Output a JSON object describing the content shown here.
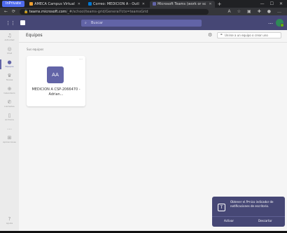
{
  "browser": {
    "profile": "InPrivate",
    "tabs": [
      {
        "label": "AMECA Campus Virtual",
        "color": "#f0a030",
        "active": false
      },
      {
        "label": "Correo: MEDICION A - Outl",
        "color": "#0078d4",
        "active": false
      },
      {
        "label": "Microsoft Teams (work or sc",
        "color": "#6264a7",
        "active": true
      }
    ],
    "new_tab": "+",
    "url_host": "teams.microsoft.com",
    "url_path": "/_#/school/teams-grid/General?ctx=teamsGrid"
  },
  "teams_header": {
    "search_placeholder": "Buscar"
  },
  "rail": {
    "items": [
      {
        "icon": "bell-icon",
        "label": "Actividad"
      },
      {
        "icon": "chat-icon",
        "label": "Chat"
      },
      {
        "icon": "teams-icon",
        "label": "Equipos",
        "active": true
      },
      {
        "icon": "assignments-icon",
        "label": "Tareas"
      },
      {
        "icon": "calendar-icon",
        "label": "Calendario"
      },
      {
        "icon": "calls-icon",
        "label": "Llamadas"
      },
      {
        "icon": "files-icon",
        "label": "Archivos"
      },
      {
        "icon": "more-icon",
        "label": ""
      },
      {
        "icon": "apps-icon",
        "label": "Aplicaciones"
      },
      {
        "icon": "help-icon",
        "label": "Ayuda"
      }
    ]
  },
  "main": {
    "title": "Equipos",
    "join_button": "Unirse a un equipo o crear uno",
    "section_label": "Sus equipos",
    "teams": [
      {
        "initials": "AA",
        "name": "MEDICION A CSP-2066470 - Adrian..."
      }
    ]
  },
  "notification": {
    "text": "Obtener el Ãºnico indicador de notificaciones de escritorio.",
    "primary": "Activar",
    "secondary": "Descartar"
  },
  "colors": {
    "teams_purple": "#6264a7",
    "teams_header": "#464775"
  }
}
